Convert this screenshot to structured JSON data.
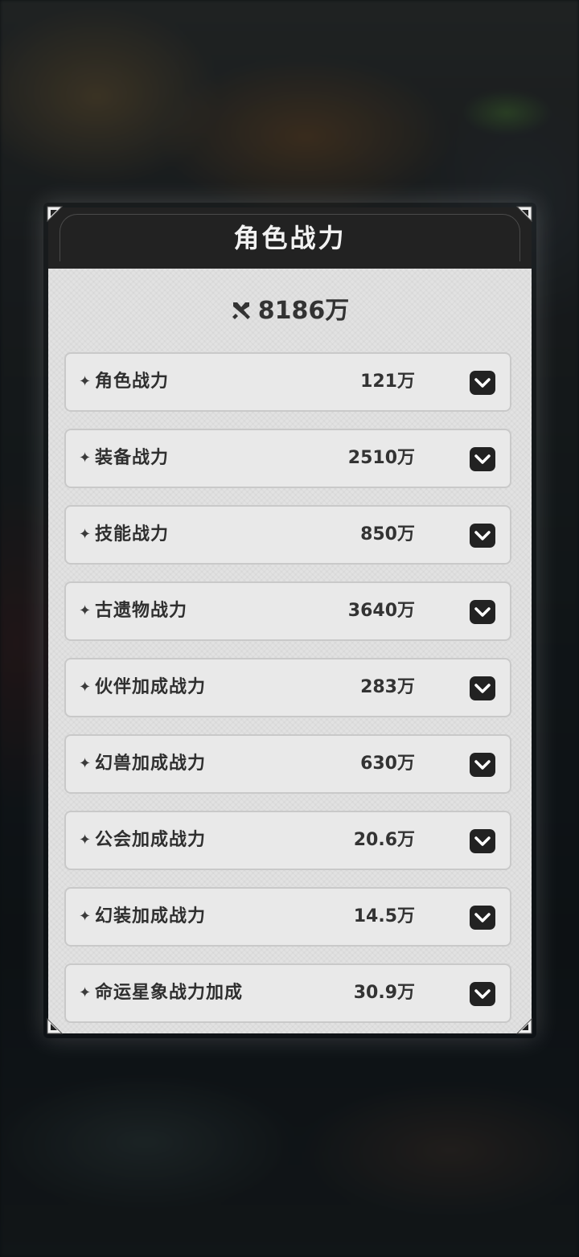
{
  "dialog": {
    "title": "角色战力",
    "total": "8186万",
    "total_icon": "crossed-swords-icon",
    "items": [
      {
        "label": "角色战力",
        "value": "121万"
      },
      {
        "label": "装备战力",
        "value": "2510万"
      },
      {
        "label": "技能战力",
        "value": "850万"
      },
      {
        "label": "古遗物战力",
        "value": "3640万"
      },
      {
        "label": "伙伴加成战力",
        "value": "283万"
      },
      {
        "label": "幻兽加成战力",
        "value": "630万"
      },
      {
        "label": "公会加成战力",
        "value": "20.6万"
      },
      {
        "label": "幻装加成战力",
        "value": "14.5万"
      },
      {
        "label": "命运星象战力加成",
        "value": "30.9万"
      }
    ],
    "row_marker": "✦",
    "toggle_icon": "chevron-down-icon"
  },
  "colors": {
    "header_bg": "#222222",
    "panel_bg": "#e2e2e2",
    "row_bg": "#e9e9e9",
    "row_border": "#c9c9c9",
    "text": "#333333"
  }
}
